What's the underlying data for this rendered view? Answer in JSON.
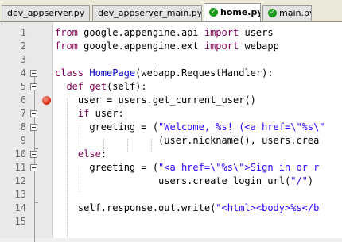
{
  "tabs": [
    {
      "label": "dev_appserver.py",
      "active": false,
      "icon": null
    },
    {
      "label": "dev_appserver_main.py",
      "active": false,
      "icon": null
    },
    {
      "label": "home.py",
      "active": true,
      "icon": "check-icon"
    },
    {
      "label": "main.py",
      "active": false,
      "icon": "check-icon"
    }
  ],
  "line_numbers": [
    "1",
    "2",
    "3",
    "4",
    "5",
    "6",
    "7",
    "8",
    "9",
    "10",
    "11",
    "12",
    "13",
    "14",
    "15"
  ],
  "breakpoint_line": 6,
  "code_lines": [
    [
      {
        "t": "from",
        "c": "kw"
      },
      {
        "t": " google.appengine.api ",
        "c": "pl"
      },
      {
        "t": "import",
        "c": "kw"
      },
      {
        "t": " users",
        "c": "pl"
      }
    ],
    [
      {
        "t": "from",
        "c": "kw"
      },
      {
        "t": " google.appengine.ext ",
        "c": "pl"
      },
      {
        "t": "import",
        "c": "kw"
      },
      {
        "t": " webapp",
        "c": "pl"
      }
    ],
    [],
    [
      {
        "t": "class",
        "c": "kw"
      },
      {
        "t": " ",
        "c": "pl"
      },
      {
        "t": "HomePage",
        "c": "cls"
      },
      {
        "t": "(webapp.RequestHandler):",
        "c": "pl"
      }
    ],
    [
      {
        "t": "  ",
        "c": "pl"
      },
      {
        "t": "def",
        "c": "kw"
      },
      {
        "t": " ",
        "c": "pl"
      },
      {
        "t": "get",
        "c": "fn"
      },
      {
        "t": "(self):",
        "c": "pl"
      }
    ],
    [
      {
        "t": "    user = users.get_current_user()",
        "c": "pl"
      }
    ],
    [
      {
        "t": "    ",
        "c": "pl"
      },
      {
        "t": "if",
        "c": "kw"
      },
      {
        "t": " user:",
        "c": "pl"
      }
    ],
    [
      {
        "t": "      greeting = (",
        "c": "pl"
      },
      {
        "t": "\"Welcome, %s! (<a href=\\\"%s\\\"",
        "c": "str"
      }
    ],
    [
      {
        "t": "                  (user.nickname(), users.crea",
        "c": "pl"
      }
    ],
    [
      {
        "t": "    ",
        "c": "pl"
      },
      {
        "t": "else",
        "c": "kw"
      },
      {
        "t": ":",
        "c": "pl"
      }
    ],
    [
      {
        "t": "      greeting = (",
        "c": "pl"
      },
      {
        "t": "\"<a href=\\\"%s\\\">Sign in or r",
        "c": "str"
      }
    ],
    [
      {
        "t": "                  users.create_login_url(",
        "c": "pl"
      },
      {
        "t": "\"/\"",
        "c": "str"
      },
      {
        "t": ")",
        "c": "pl"
      }
    ],
    [],
    [
      {
        "t": "    self.response.out.write(",
        "c": "pl"
      },
      {
        "t": "\"<html><body>%s</b",
        "c": "str"
      }
    ],
    []
  ]
}
